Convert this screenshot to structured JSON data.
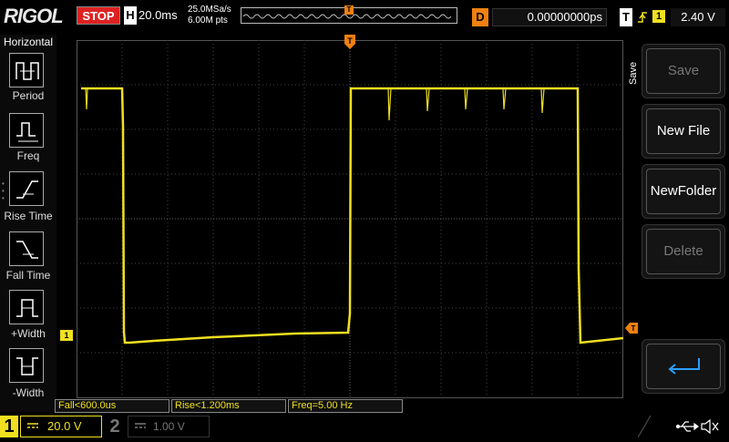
{
  "top": {
    "logo": "RIGOL",
    "run_status": "STOP",
    "h_label": "H",
    "timebase": "20.0ms",
    "sample_rate": "25.0MSa/s",
    "memory_points": "6.00M pts",
    "mem_trig_marker": "T",
    "d_label": "D",
    "delay": "0.00000000ps",
    "t_label": "T",
    "trigger_source": "1",
    "trigger_level": "2.40 V",
    "colors": {
      "stop": "#d22222",
      "trigger": "#f08010",
      "ch1": "#f0e020"
    }
  },
  "left_menu": {
    "title": "Horizontal",
    "items": [
      {
        "label": "Period",
        "icon": "period-icon"
      },
      {
        "label": "Freq",
        "icon": "freq-icon"
      },
      {
        "label": "Rise Time",
        "icon": "rise-time-icon"
      },
      {
        "label": "Fall Time",
        "icon": "fall-time-icon"
      },
      {
        "label": "+Width",
        "icon": "plus-width-icon"
      },
      {
        "label": "-Width",
        "icon": "minus-width-icon"
      }
    ]
  },
  "waveform": {
    "trigger_marker": "T",
    "ch1_marker": "1",
    "trigger_level_marker": "T"
  },
  "right_menu": {
    "tab": "Save",
    "items": [
      {
        "label": "Save",
        "enabled": false
      },
      {
        "label": "New File",
        "enabled": true
      },
      {
        "label": "NewFolder",
        "enabled": true
      },
      {
        "label": "Delete",
        "enabled": false
      },
      {
        "label": "",
        "icon": "return-icon",
        "enabled": true
      }
    ]
  },
  "measurements": [
    "Fall<600.0us",
    "Rise<1.200ms",
    "Freq=5.00 Hz"
  ],
  "bottom": {
    "ch1_number": "1",
    "ch1_scale": "20.0 V",
    "ch2_number": "2",
    "ch2_scale": "1.00 V",
    "usb_icon": "usb-icon",
    "speaker_icon": "speaker-muted-icon"
  }
}
